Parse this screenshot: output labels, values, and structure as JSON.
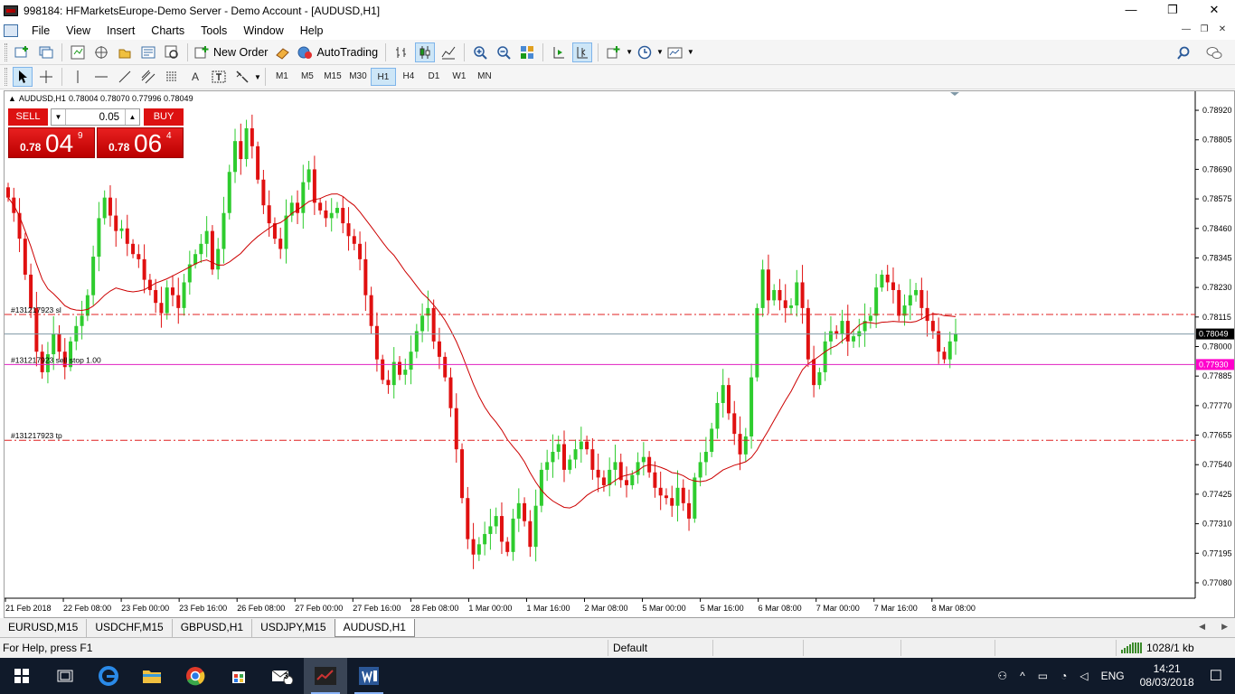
{
  "window": {
    "title": "998184: HFMarketsEurope-Demo Server - Demo Account - [AUDUSD,H1]",
    "min": "—",
    "max": "❐",
    "close": "✕"
  },
  "menu": [
    "File",
    "View",
    "Insert",
    "Charts",
    "Tools",
    "Window",
    "Help"
  ],
  "toolbar": {
    "new_order": "New Order",
    "autotrading": "AutoTrading",
    "timeframes": [
      "M1",
      "M5",
      "M15",
      "M30",
      "H1",
      "H4",
      "D1",
      "W1",
      "MN"
    ],
    "active_timeframe": "H1"
  },
  "chart": {
    "symbol": "AUDUSD,H1",
    "ohlc": "0.78004 0.78070 0.77996 0.78049",
    "trade_panel": {
      "sell_label": "SELL",
      "buy_label": "BUY",
      "lots": "0.05",
      "sell_small": "0.78",
      "sell_big": "04",
      "sell_exp": "9",
      "buy_small": "0.78",
      "buy_big": "06",
      "buy_exp": "4"
    },
    "order_lines": [
      {
        "label": "#131217923 sl",
        "price": 0.78125,
        "color": "#e02020",
        "style": "dashdot"
      },
      {
        "label": "#131217923 sell stop 1.00",
        "price": 0.7793,
        "color": "#e020c0",
        "style": "solid"
      },
      {
        "label": "#131217923 tp",
        "price": 0.77635,
        "color": "#e02020",
        "style": "dashdot"
      }
    ],
    "bid_line": {
      "price": 0.78049,
      "label": "0.78049",
      "color": "#7f98a6"
    },
    "sellstop_tag": {
      "label": "0.77930",
      "color": "#ff00cc"
    }
  },
  "chart_data": {
    "type": "candlestick",
    "ylim": [
      0.7702,
      0.7898
    ],
    "y_ticks": [
      "0.78920",
      "0.78805",
      "0.78690",
      "0.78575",
      "0.78460",
      "0.78345",
      "0.78230",
      "0.78115",
      "0.78000",
      "0.77885",
      "0.77770",
      "0.77655",
      "0.77540",
      "0.77425",
      "0.77310",
      "0.77195",
      "0.77080"
    ],
    "x_labels": [
      "21 Feb 2018",
      "22 Feb 08:00",
      "23 Feb 00:00",
      "23 Feb 16:00",
      "26 Feb 08:00",
      "27 Feb 00:00",
      "27 Feb 16:00",
      "28 Feb 08:00",
      "1 Mar 00:00",
      "1 Mar 16:00",
      "2 Mar 08:00",
      "5 Mar 00:00",
      "5 Mar 16:00",
      "6 Mar 08:00",
      "7 Mar 00:00",
      "7 Mar 16:00",
      "8 Mar 08:00"
    ],
    "closes": [
      0.7858,
      0.7852,
      0.7842,
      0.7828,
      0.7815,
      0.7798,
      0.779,
      0.7797,
      0.7805,
      0.7798,
      0.7792,
      0.7802,
      0.7808,
      0.7812,
      0.782,
      0.7835,
      0.785,
      0.7858,
      0.7851,
      0.7845,
      0.7846,
      0.784,
      0.7836,
      0.7834,
      0.7826,
      0.7822,
      0.7817,
      0.7813,
      0.7823,
      0.782,
      0.7815,
      0.7825,
      0.7832,
      0.7836,
      0.784,
      0.7845,
      0.783,
      0.7838,
      0.7852,
      0.7868,
      0.788,
      0.7873,
      0.7885,
      0.7878,
      0.7865,
      0.7855,
      0.7848,
      0.7842,
      0.7838,
      0.7851,
      0.7856,
      0.7852,
      0.7864,
      0.7869,
      0.7856,
      0.7853,
      0.785,
      0.7852,
      0.7854,
      0.7848,
      0.7843,
      0.784,
      0.7834,
      0.782,
      0.7808,
      0.7795,
      0.7787,
      0.7785,
      0.7794,
      0.7789,
      0.7791,
      0.7798,
      0.7806,
      0.7812,
      0.7815,
      0.7802,
      0.7796,
      0.7788,
      0.7776,
      0.776,
      0.7741,
      0.7725,
      0.7719,
      0.7723,
      0.7727,
      0.773,
      0.7734,
      0.7724,
      0.772,
      0.7733,
      0.7739,
      0.7732,
      0.7722,
      0.7738,
      0.7752,
      0.7755,
      0.7759,
      0.7762,
      0.7752,
      0.7756,
      0.776,
      0.7763,
      0.776,
      0.7752,
      0.7749,
      0.7746,
      0.7752,
      0.7755,
      0.7748,
      0.7746,
      0.775,
      0.7755,
      0.7757,
      0.7751,
      0.7745,
      0.7742,
      0.7741,
      0.7738,
      0.7745,
      0.7739,
      0.7733,
      0.7749,
      0.7755,
      0.7759,
      0.7768,
      0.7778,
      0.7785,
      0.7774,
      0.7766,
      0.7758,
      0.7765,
      0.7788,
      0.7815,
      0.783,
      0.7818,
      0.7822,
      0.7818,
      0.7815,
      0.7816,
      0.7825,
      0.7815,
      0.7795,
      0.7785,
      0.779,
      0.7802,
      0.7806,
      0.7805,
      0.781,
      0.7802,
      0.7804,
      0.7806,
      0.781,
      0.7812,
      0.7823,
      0.7828,
      0.7825,
      0.7822,
      0.7812,
      0.7816,
      0.782,
      0.7822,
      0.7815,
      0.781,
      0.7806,
      0.7798,
      0.7795,
      0.7802,
      0.7805
    ]
  },
  "tabs": [
    "EURUSD,M15",
    "USDCHF,M15",
    "GBPUSD,H1",
    "USDJPY,M15",
    "AUDUSD,H1"
  ],
  "active_tab": "AUDUSD,H1",
  "status": {
    "help": "For Help, press F1",
    "profile": "Default",
    "traffic": "1028/1 kb"
  },
  "taskbar": {
    "mail_badge": "3",
    "lang": "ENG",
    "time": "14:21",
    "date": "08/03/2018"
  }
}
